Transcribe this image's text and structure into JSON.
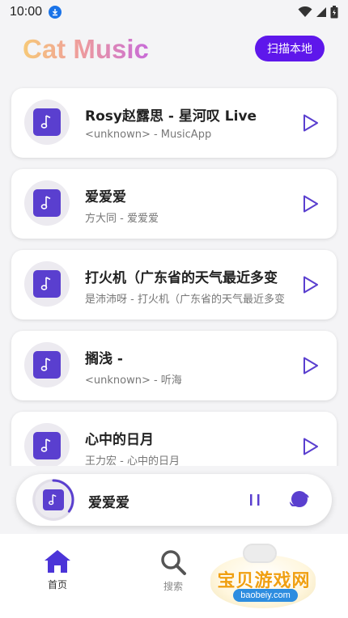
{
  "status_bar": {
    "time": "10:00"
  },
  "header": {
    "app_title": "Cat Music",
    "scan_button": "扫描本地"
  },
  "songs": [
    {
      "title": "Rosy赵露思 - 星河叹 Live",
      "subtitle": "<unknown> - MusicApp"
    },
    {
      "title": "爱爱爱",
      "subtitle": "方大同 - 爱爱爱"
    },
    {
      "title": "打火机（广东省的天气最近多变",
      "subtitle": "是沛沛呀 - 打火机（广东省的天气最近多变"
    },
    {
      "title": "搁浅 -",
      "subtitle": "<unknown> - 听海"
    },
    {
      "title": "心中的日月",
      "subtitle": "王力宏 - 心中的日月"
    }
  ],
  "mini_player": {
    "title": "爱爱爱",
    "progress": 0.35
  },
  "bottom_nav": {
    "home_label": "首页",
    "search_label": "搜索"
  },
  "watermark": {
    "text": "宝贝游戏网",
    "domain": "baobeiy.com"
  },
  "colors": {
    "accent": "#5e17eb",
    "album": "#5a3fcf",
    "play_icon": "#5a3fcf"
  },
  "icons": {
    "download": "download-icon",
    "wifi": "wifi-icon",
    "signal": "signal-icon",
    "battery": "battery-icon",
    "note": "music-note-icon",
    "play": "play-icon",
    "pause": "pause-icon",
    "list": "playlist-icon",
    "home": "home-icon",
    "search": "search-icon"
  }
}
